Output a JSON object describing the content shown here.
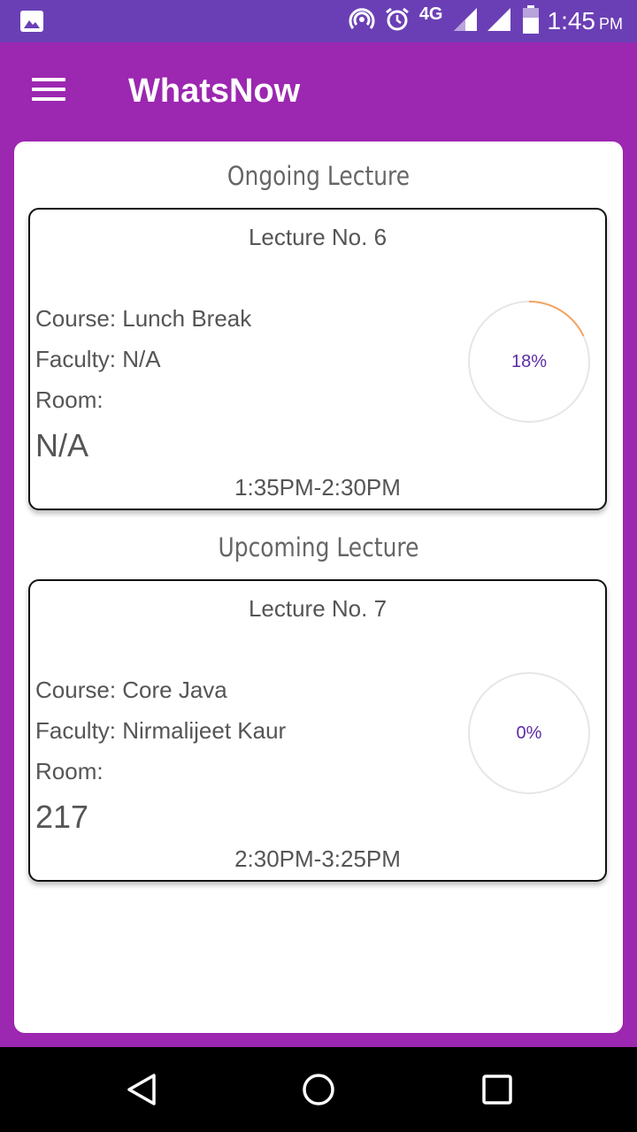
{
  "status_bar": {
    "network": "4G",
    "time": "1:45",
    "ampm": "PM",
    "icons": [
      "image-icon",
      "hotspot-icon",
      "alarm-icon",
      "signal-icon",
      "battery-icon"
    ]
  },
  "app_bar": {
    "title": "WhatsNow"
  },
  "ongoing": {
    "section_title": "Ongoing Lecture",
    "lecture_no": "Lecture No. 6",
    "course": "Course: Lunch Break",
    "faculty": "Faculty: N/A",
    "room_label": "Room:",
    "room_value": "N/A",
    "time_range": "1:35PM-2:30PM",
    "progress_label": "18%",
    "progress": 0.18
  },
  "upcoming": {
    "section_title": "Upcoming Lecture",
    "lecture_no": "Lecture No. 7",
    "course": "Course: Core Java",
    "faculty": "Faculty: Nirmalijeet Kaur",
    "room_label": "Room:",
    "room_value": "217",
    "time_range": "2:30PM-3:25PM",
    "progress_label": "0%",
    "progress": 0
  },
  "colors": {
    "primary": "#9C27B0",
    "status_bar": "#6A3FB5",
    "progress_arc": "#F4A460",
    "progress_text": "#5E2CA5"
  }
}
